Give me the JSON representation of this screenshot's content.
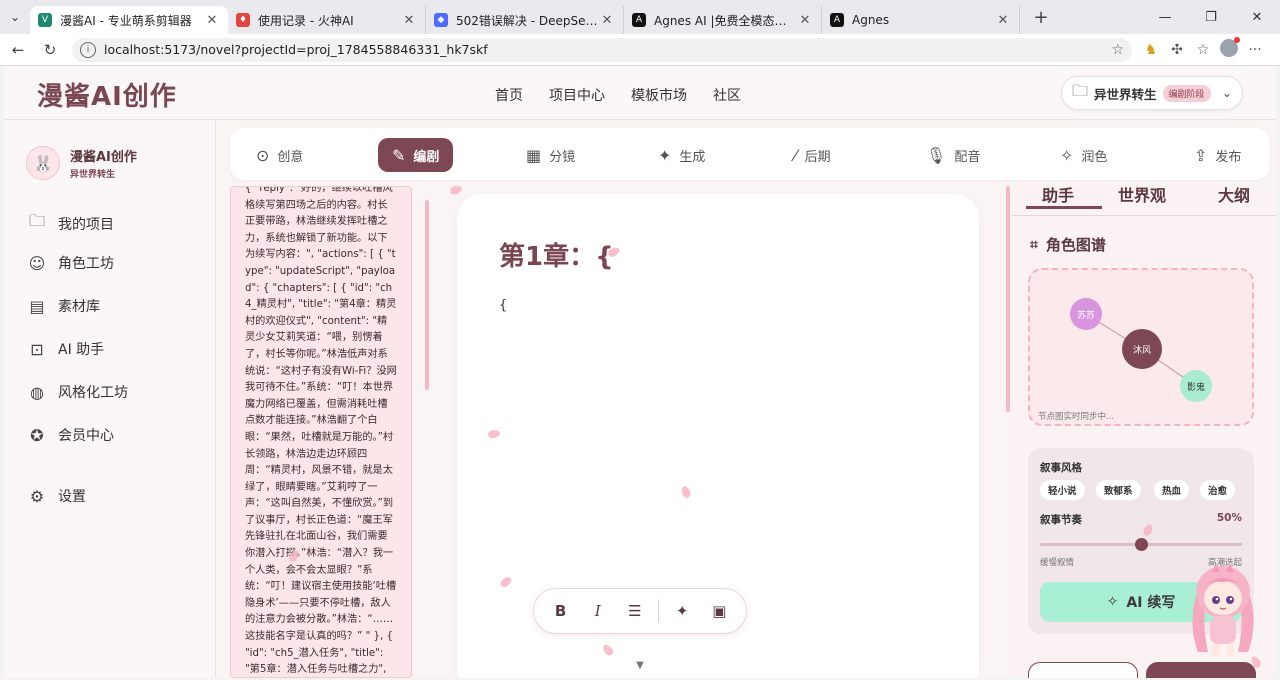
{
  "browser": {
    "tabs": [
      {
        "title": "漫酱AI - 专业萌系剪辑器",
        "fav_color": "#1f8a6f",
        "fav_glyph": "V",
        "active": true
      },
      {
        "title": "使用记录 - 火神AI",
        "fav_color": "#e2453c",
        "fav_glyph": "♦",
        "active": false
      },
      {
        "title": "502错误解决 - DeepSeek",
        "fav_color": "#4d6bfe",
        "fav_glyph": "◆",
        "active": false
      },
      {
        "title": "Agnes AI |免费全模态人工智能API",
        "fav_color": "#111111",
        "fav_glyph": "A",
        "active": false
      },
      {
        "title": "Agnes",
        "fav_color": "#111111",
        "fav_glyph": "A",
        "active": false
      }
    ],
    "url": "localhost:5173/novel?projectId=proj_1784558846331_hk7skf"
  },
  "header": {
    "logo": "漫酱AI创作",
    "nav": [
      "首页",
      "项目中心",
      "模板市场",
      "社区"
    ],
    "project_name": "异世界转生",
    "project_stage": "编剧阶段"
  },
  "sidebar": {
    "brand_name": "漫酱AI创作",
    "brand_sub": "异世界转生",
    "items": [
      {
        "label": "我的项目",
        "icon": "folder-icon"
      },
      {
        "label": "角色工坊",
        "icon": "face-icon"
      },
      {
        "label": "素材库",
        "icon": "archive-icon"
      },
      {
        "label": "AI 助手",
        "icon": "robot-icon"
      },
      {
        "label": "风格化工坊",
        "icon": "palette-icon"
      },
      {
        "label": "会员中心",
        "icon": "star-badge-icon"
      },
      {
        "label": "设置",
        "icon": "gear-icon"
      }
    ]
  },
  "stages": [
    {
      "label": "创意",
      "icon": "check-circle-icon"
    },
    {
      "label": "编剧",
      "icon": "edit-lines-icon",
      "active": true
    },
    {
      "label": "分镜",
      "icon": "film-icon"
    },
    {
      "label": "生成",
      "icon": "sparkles-icon"
    },
    {
      "label": "后期",
      "icon": "brush-icon"
    },
    {
      "label": "配音",
      "icon": "microphone-icon"
    },
    {
      "label": "润色",
      "icon": "magic-wand-icon"
    },
    {
      "label": "发布",
      "icon": "upload-icon"
    }
  ],
  "script_text": "{ \"reply\": \"好的，继续以吐槽风格续写第四场之后的内容。村长正要带路，林浩继续发挥吐槽之力，系统也解锁了新功能。以下为续写内容：\", \"actions\": [ { \"type\": \"updateScript\", \"payload\": { \"chapters\": [ { \"id\": \"ch4_精灵村\", \"title\": \"第4章：精灵村的欢迎仪式\", \"content\": \"精灵少女艾莉笑道：“喂，别愣着了，村长等你呢。”林浩低声对系统说：“这村子有没有Wi-Fi？没网我可待不住。”系统：“叮！本世界魔力网络已覆盖，但需消耗吐槽点数才能连接。”林浩翻了个白眼：“果然，吐槽就是万能的。”村长领路，林浩边走边环顾四周：“精灵村，风景不错，就是太绿了，眼睛要瞎。”艾莉哼了一声：“这叫自然美，不懂欣赏。”到了议事厅，村长正色道：“魔王军先锋驻扎在北面山谷，我们需要你潜入打探。”林浩：“潜入？我一个人类，会不会太显眼？”系统：“叮！建议宿主使用技能‘吐槽隐身术’——只要不停吐槽，敌人的注意力会被分散。”林浩：“……这技能名字是认真的吗？” \" }, { \"id\": \"ch5_潜入任务\", \"title\": \"第5章：潜入任务与吐槽之力\", \"content\": \"林浩按照系",
  "editor": {
    "chapter_title": "第1章：{",
    "body": "{"
  },
  "right_panel": {
    "tabs": [
      "助手",
      "世界观",
      "大纲"
    ],
    "graph_title": "角色图谱",
    "nodes": [
      {
        "label": "苏苏",
        "color": "#d894dd"
      },
      {
        "label": "沐风",
        "color": "#7e4754"
      },
      {
        "label": "影鬼",
        "color": "#a9ecd0"
      }
    ],
    "graph_footer": "节点图实时同步中...",
    "style_label": "叙事风格",
    "style_chips": [
      "轻小说",
      "致郁系",
      "热血",
      "治愈"
    ],
    "pace_label": "叙事节奏",
    "pace_value": "50%",
    "pace_fraction": 0.5,
    "pace_left": "缓慢叙情",
    "pace_right": "高潮迭起",
    "ai_button": "AI 续写"
  },
  "colors": {
    "accent": "#7e4754",
    "pink": "#fce6ea",
    "mint": "#a8efd3"
  }
}
